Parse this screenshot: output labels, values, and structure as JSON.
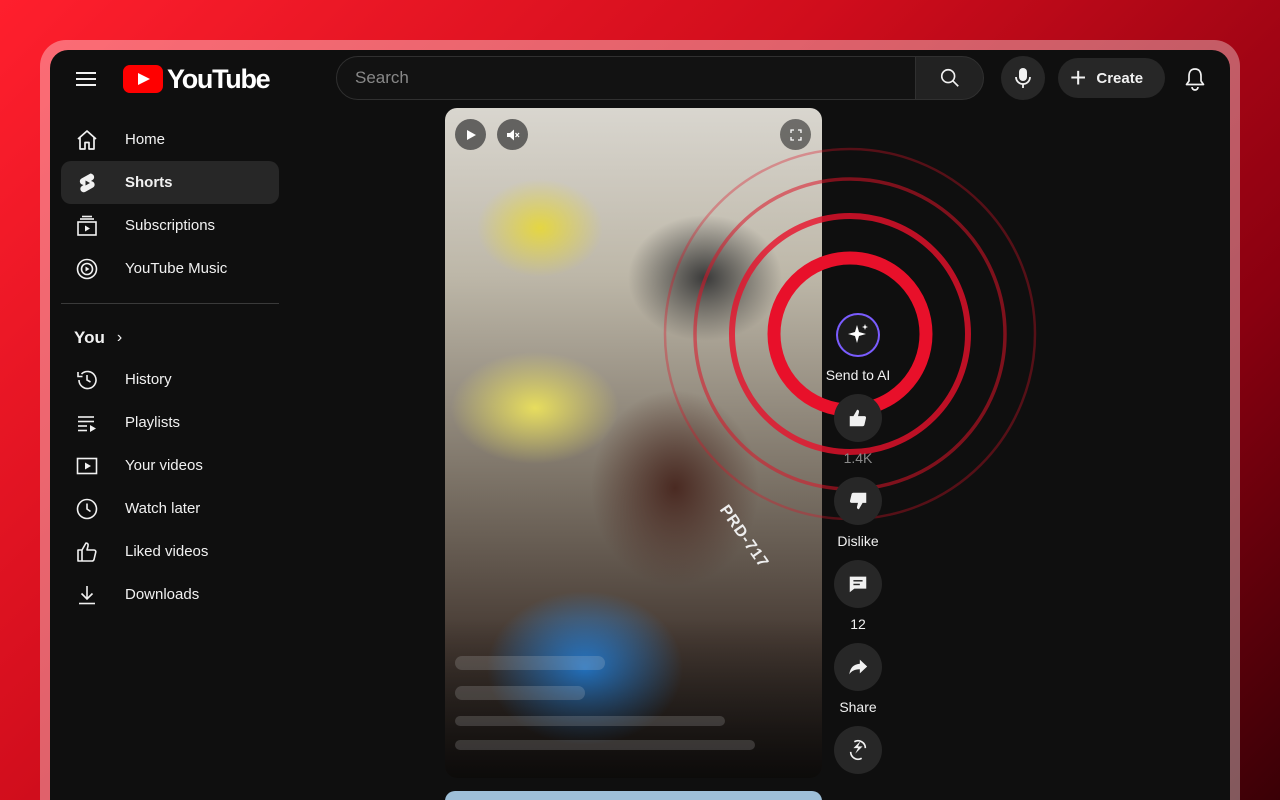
{
  "header": {
    "logo_text": "YouTube",
    "search_placeholder": "Search",
    "create_label": "Create"
  },
  "sidebar": {
    "items": [
      {
        "label": "Home",
        "icon": "home-icon"
      },
      {
        "label": "Shorts",
        "icon": "shorts-icon",
        "active": true
      },
      {
        "label": "Subscriptions",
        "icon": "subscriptions-icon"
      },
      {
        "label": "YouTube Music",
        "icon": "youtube-music-icon"
      }
    ],
    "you_label": "You",
    "you_items": [
      {
        "label": "History",
        "icon": "history-icon"
      },
      {
        "label": "Playlists",
        "icon": "playlists-icon"
      },
      {
        "label": "Your videos",
        "icon": "your-videos-icon"
      },
      {
        "label": "Watch later",
        "icon": "watch-later-icon"
      },
      {
        "label": "Liked videos",
        "icon": "liked-videos-icon"
      },
      {
        "label": "Downloads",
        "icon": "downloads-icon"
      }
    ]
  },
  "video": {
    "overlay_text": "PRD-717"
  },
  "actions": {
    "send_to_ai": "Send to AI",
    "like_count": "1.4K",
    "dislike": "Dislike",
    "comments_count": "12",
    "share": "Share"
  },
  "colors": {
    "accent": "#ff0000",
    "highlight_ring": "#e8102a",
    "background": "#0f0f0f"
  }
}
